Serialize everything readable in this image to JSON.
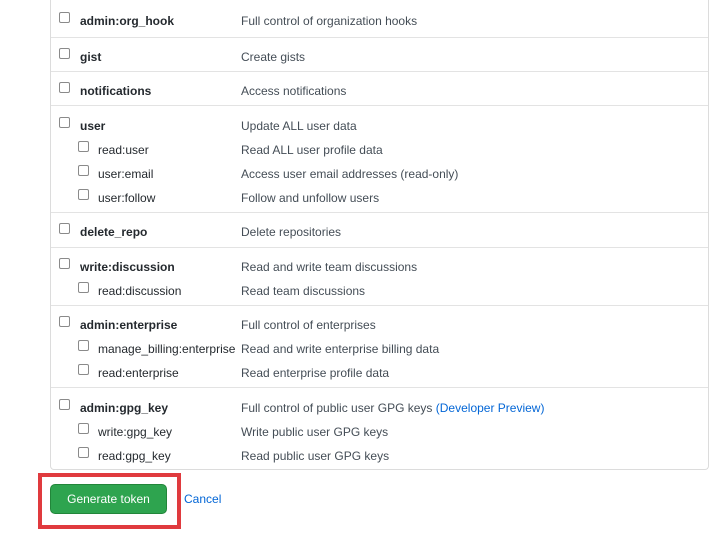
{
  "scopes": [
    {
      "name": "admin:org_hook",
      "desc": "Full control of organization hooks"
    },
    {
      "name": "gist",
      "desc": "Create gists"
    },
    {
      "name": "notifications",
      "desc": "Access notifications"
    },
    {
      "name": "user",
      "desc": "Update ALL user data",
      "children": [
        {
          "name": "read:user",
          "desc": "Read ALL user profile data"
        },
        {
          "name": "user:email",
          "desc": "Access user email addresses (read-only)"
        },
        {
          "name": "user:follow",
          "desc": "Follow and unfollow users"
        }
      ]
    },
    {
      "name": "delete_repo",
      "desc": "Delete repositories"
    },
    {
      "name": "write:discussion",
      "desc": "Read and write team discussions",
      "children": [
        {
          "name": "read:discussion",
          "desc": "Read team discussions"
        }
      ]
    },
    {
      "name": "admin:enterprise",
      "desc": "Full control of enterprises",
      "children": [
        {
          "name": "manage_billing:enterprise",
          "desc": "Read and write enterprise billing data"
        },
        {
          "name": "read:enterprise",
          "desc": "Read enterprise profile data"
        }
      ]
    },
    {
      "name": "admin:gpg_key",
      "desc": "Full control of public user GPG keys",
      "link": "(Developer Preview)",
      "children": [
        {
          "name": "write:gpg_key",
          "desc": "Write public user GPG keys"
        },
        {
          "name": "read:gpg_key",
          "desc": "Read public user GPG keys"
        }
      ]
    }
  ],
  "actions": {
    "generate_label": "Generate token",
    "cancel_label": "Cancel"
  },
  "colors": {
    "primary_button": "#2ea44f",
    "link": "#0366d6",
    "highlight": "#e03a3e"
  }
}
